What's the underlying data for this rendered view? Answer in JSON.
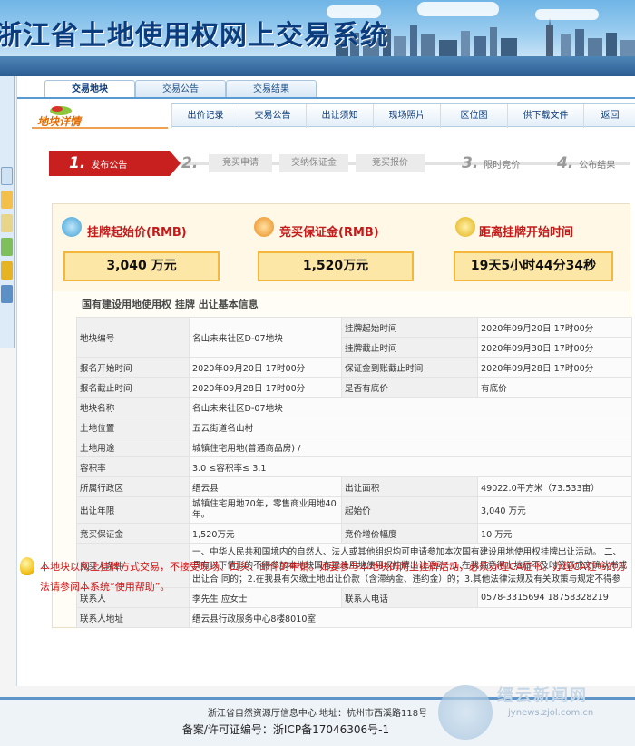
{
  "banner": {
    "title": "浙江省土地使用权网上交易系统"
  },
  "tabs": [
    {
      "label": "交易地块"
    },
    {
      "label": "交易公告"
    },
    {
      "label": "交易结果"
    }
  ],
  "section": {
    "label": "地块详情"
  },
  "nav": [
    {
      "label": "出价记录"
    },
    {
      "label": "交易公告"
    },
    {
      "label": "出让须知"
    },
    {
      "label": "现场照片"
    },
    {
      "label": "区位图"
    },
    {
      "label": "供下载文件"
    },
    {
      "label": "返回"
    }
  ],
  "steps": [
    {
      "num": "1.",
      "label": "发布公告"
    },
    {
      "num": "2.",
      "label": ""
    },
    {
      "label": "竞买申请"
    },
    {
      "label": "交纳保证金"
    },
    {
      "label": "竞买报价"
    },
    {
      "num": "3.",
      "label": "限时竞价"
    },
    {
      "num": "4.",
      "label": "公布结果"
    }
  ],
  "cards": {
    "start_price": {
      "title": "挂牌起始价(RMB)",
      "value": "3,040 万元"
    },
    "deposit": {
      "title": "竞买保证金(RMB)",
      "value": "1,520万元"
    },
    "countdown": {
      "title": "距离挂牌开始时间",
      "value": "19天5小时44分34秒"
    }
  },
  "info_title": "国有建设用地使用权 挂牌 出让基本信息",
  "info": {
    "r1": {
      "l1": "地块编号",
      "v1": "名山未来社区D-07地块",
      "l2a": "挂牌起始时间",
      "v2a": "2020年09月20日 17时00分",
      "l2b": "挂牌截止时间",
      "v2b": "2020年09月30日 17时00分"
    },
    "r2": {
      "l1": "报名开始时间",
      "v1": "2020年09月20日 17时00分",
      "l2": "保证金到账截止时间",
      "v2": "2020年09月28日 17时00分"
    },
    "r3": {
      "l1": "报名截止时间",
      "v1": "2020年09月28日 17时00分",
      "l2": "是否有底价",
      "v2": "有底价"
    },
    "r4": {
      "l1": "地块名称",
      "v1": "名山未来社区D-07地块"
    },
    "r5": {
      "l1": "土地位置",
      "v1": "五云街道名山村"
    },
    "r6": {
      "l1": "土地用途",
      "v1": "城镇住宅用地(普通商品房) /"
    },
    "r7": {
      "l1": "容积率",
      "v1": "3.0 ≤容积率≤ 3.1"
    },
    "r8": {
      "l1": "所属行政区",
      "v1": "缙云县",
      "l2": "出让面积",
      "v2": "49022.0平方米（73.533亩）"
    },
    "r9": {
      "l1": "出让年限",
      "v1": "城镇住宅用地70年，零售商业用地40年。",
      "l2": "起始价",
      "v2": "3,040 万元"
    },
    "r10": {
      "l1": "竞买保证金",
      "v1": "1,520万元",
      "l2": "竞价增价幅度",
      "v2": "10 万元"
    },
    "r11": {
      "l1": "竞买人条件",
      "v1": "一、中华人民共和国境内的自然人、法人或其他组织均可申请参加本次国有建设用地使用权挂牌出让活动。 二、具有以下情形的不得参加本地块国有建设用地使用权挂牌出让活动：1.在我县竞得土地后不及时签订成交确认书或出让合 同的；2.在我县有欠缴土地出让价款（含滞纳金、违约金）的；3.其他法律法规及有关政策与规定不得参加本次国 有建设用地使用权挂牌出让活动的"
    },
    "r12": {
      "l1": "联系人",
      "v1": "李先生 应女士",
      "l2": "联系人电话",
      "v2": "0578-3315694 18758328219"
    },
    "r13": {
      "l1": "联系人地址",
      "v1": "缙云县行政服务中心8楼8010室"
    }
  },
  "notice": "本地块以网上挂牌方式交易，不接受现场、口头、邮件的申请。如要参与本地块的网上挂牌活动，必须办理CA证书。办理CA证书的方法请参阅本系统“使用帮助”。",
  "footer": {
    "line1": "浙江省自然资源厅信息中心 地址：杭州市西溪路118号",
    "line2": "备案/许可证编号：浙ICP备17046306号-1"
  },
  "watermark": {
    "name": "缙云新闻网",
    "url": "jynews.zjol.com.cn"
  },
  "colors": {
    "accent_red": "#c8201f",
    "nav_blue": "#0b3c7d",
    "card_fill": "#fde7a6"
  }
}
